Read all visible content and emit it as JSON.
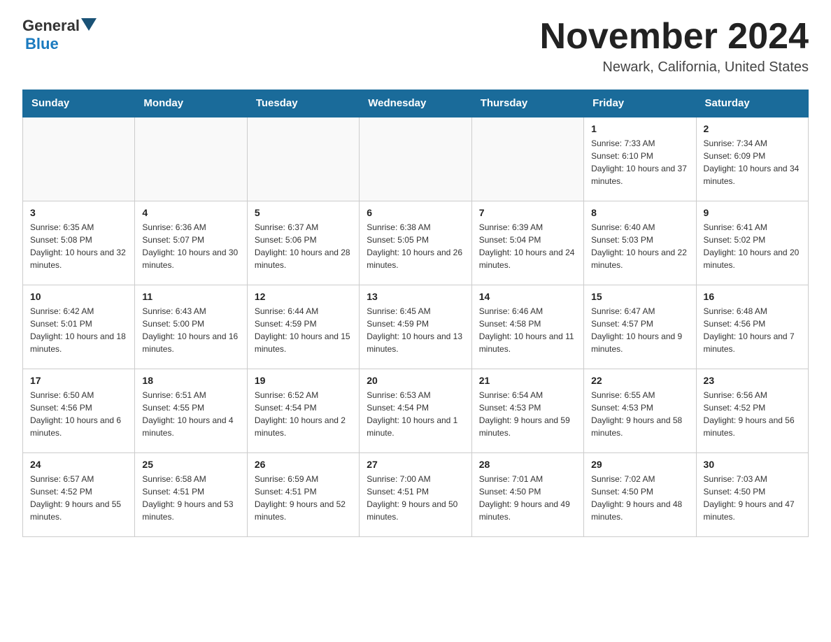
{
  "logo": {
    "general": "General",
    "blue": "Blue"
  },
  "header": {
    "month_year": "November 2024",
    "location": "Newark, California, United States"
  },
  "weekdays": [
    "Sunday",
    "Monday",
    "Tuesday",
    "Wednesday",
    "Thursday",
    "Friday",
    "Saturday"
  ],
  "rows": [
    [
      {
        "day": "",
        "info": ""
      },
      {
        "day": "",
        "info": ""
      },
      {
        "day": "",
        "info": ""
      },
      {
        "day": "",
        "info": ""
      },
      {
        "day": "",
        "info": ""
      },
      {
        "day": "1",
        "info": "Sunrise: 7:33 AM\nSunset: 6:10 PM\nDaylight: 10 hours and 37 minutes."
      },
      {
        "day": "2",
        "info": "Sunrise: 7:34 AM\nSunset: 6:09 PM\nDaylight: 10 hours and 34 minutes."
      }
    ],
    [
      {
        "day": "3",
        "info": "Sunrise: 6:35 AM\nSunset: 5:08 PM\nDaylight: 10 hours and 32 minutes."
      },
      {
        "day": "4",
        "info": "Sunrise: 6:36 AM\nSunset: 5:07 PM\nDaylight: 10 hours and 30 minutes."
      },
      {
        "day": "5",
        "info": "Sunrise: 6:37 AM\nSunset: 5:06 PM\nDaylight: 10 hours and 28 minutes."
      },
      {
        "day": "6",
        "info": "Sunrise: 6:38 AM\nSunset: 5:05 PM\nDaylight: 10 hours and 26 minutes."
      },
      {
        "day": "7",
        "info": "Sunrise: 6:39 AM\nSunset: 5:04 PM\nDaylight: 10 hours and 24 minutes."
      },
      {
        "day": "8",
        "info": "Sunrise: 6:40 AM\nSunset: 5:03 PM\nDaylight: 10 hours and 22 minutes."
      },
      {
        "day": "9",
        "info": "Sunrise: 6:41 AM\nSunset: 5:02 PM\nDaylight: 10 hours and 20 minutes."
      }
    ],
    [
      {
        "day": "10",
        "info": "Sunrise: 6:42 AM\nSunset: 5:01 PM\nDaylight: 10 hours and 18 minutes."
      },
      {
        "day": "11",
        "info": "Sunrise: 6:43 AM\nSunset: 5:00 PM\nDaylight: 10 hours and 16 minutes."
      },
      {
        "day": "12",
        "info": "Sunrise: 6:44 AM\nSunset: 4:59 PM\nDaylight: 10 hours and 15 minutes."
      },
      {
        "day": "13",
        "info": "Sunrise: 6:45 AM\nSunset: 4:59 PM\nDaylight: 10 hours and 13 minutes."
      },
      {
        "day": "14",
        "info": "Sunrise: 6:46 AM\nSunset: 4:58 PM\nDaylight: 10 hours and 11 minutes."
      },
      {
        "day": "15",
        "info": "Sunrise: 6:47 AM\nSunset: 4:57 PM\nDaylight: 10 hours and 9 minutes."
      },
      {
        "day": "16",
        "info": "Sunrise: 6:48 AM\nSunset: 4:56 PM\nDaylight: 10 hours and 7 minutes."
      }
    ],
    [
      {
        "day": "17",
        "info": "Sunrise: 6:50 AM\nSunset: 4:56 PM\nDaylight: 10 hours and 6 minutes."
      },
      {
        "day": "18",
        "info": "Sunrise: 6:51 AM\nSunset: 4:55 PM\nDaylight: 10 hours and 4 minutes."
      },
      {
        "day": "19",
        "info": "Sunrise: 6:52 AM\nSunset: 4:54 PM\nDaylight: 10 hours and 2 minutes."
      },
      {
        "day": "20",
        "info": "Sunrise: 6:53 AM\nSunset: 4:54 PM\nDaylight: 10 hours and 1 minute."
      },
      {
        "day": "21",
        "info": "Sunrise: 6:54 AM\nSunset: 4:53 PM\nDaylight: 9 hours and 59 minutes."
      },
      {
        "day": "22",
        "info": "Sunrise: 6:55 AM\nSunset: 4:53 PM\nDaylight: 9 hours and 58 minutes."
      },
      {
        "day": "23",
        "info": "Sunrise: 6:56 AM\nSunset: 4:52 PM\nDaylight: 9 hours and 56 minutes."
      }
    ],
    [
      {
        "day": "24",
        "info": "Sunrise: 6:57 AM\nSunset: 4:52 PM\nDaylight: 9 hours and 55 minutes."
      },
      {
        "day": "25",
        "info": "Sunrise: 6:58 AM\nSunset: 4:51 PM\nDaylight: 9 hours and 53 minutes."
      },
      {
        "day": "26",
        "info": "Sunrise: 6:59 AM\nSunset: 4:51 PM\nDaylight: 9 hours and 52 minutes."
      },
      {
        "day": "27",
        "info": "Sunrise: 7:00 AM\nSunset: 4:51 PM\nDaylight: 9 hours and 50 minutes."
      },
      {
        "day": "28",
        "info": "Sunrise: 7:01 AM\nSunset: 4:50 PM\nDaylight: 9 hours and 49 minutes."
      },
      {
        "day": "29",
        "info": "Sunrise: 7:02 AM\nSunset: 4:50 PM\nDaylight: 9 hours and 48 minutes."
      },
      {
        "day": "30",
        "info": "Sunrise: 7:03 AM\nSunset: 4:50 PM\nDaylight: 9 hours and 47 minutes."
      }
    ]
  ]
}
